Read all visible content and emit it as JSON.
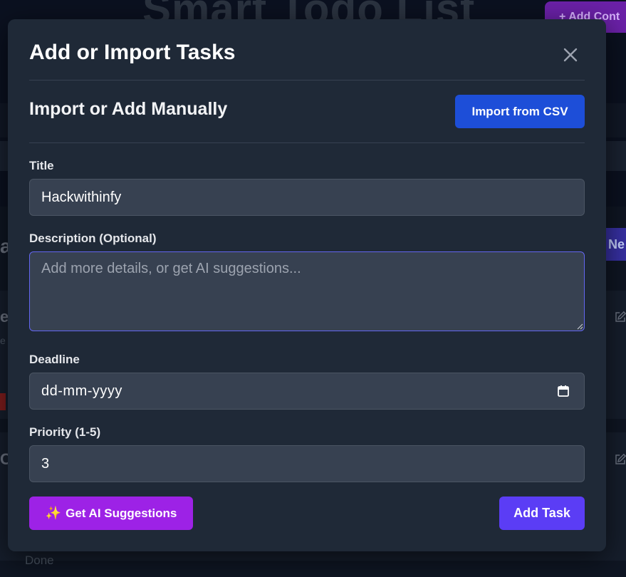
{
  "background": {
    "page_title": "Smart Todo List",
    "add_contact_label": "+ Add Cont",
    "new_button_label": "l Ne",
    "partial_heading_a": "a",
    "partial_card1_letter": "e",
    "partial_card1_sub": "e",
    "partial_card2_letter": "C",
    "done_label": "Done"
  },
  "modal": {
    "title": "Add or Import Tasks",
    "section_title": "Import or Add Manually",
    "import_button_label": "Import from CSV",
    "fields": {
      "title_label": "Title",
      "title_value": "Hackwithinfy",
      "description_label": "Description (Optional)",
      "description_placeholder": "Add more details, or get AI suggestions...",
      "description_value": "",
      "deadline_label": "Deadline",
      "deadline_placeholder": "dd-mm-yyyy",
      "priority_label": "Priority (1-5)",
      "priority_value": "3"
    },
    "ai_button_label": "Get AI Suggestions",
    "ai_button_icon": "sparkles-icon",
    "add_button_label": "Add Task"
  },
  "colors": {
    "modal_bg": "#1f2937",
    "input_bg": "#374151",
    "import_button": "#1d4ed8",
    "ai_button": "#9d22e6",
    "add_button": "#5b3df5",
    "focus_border": "#6366f1"
  }
}
